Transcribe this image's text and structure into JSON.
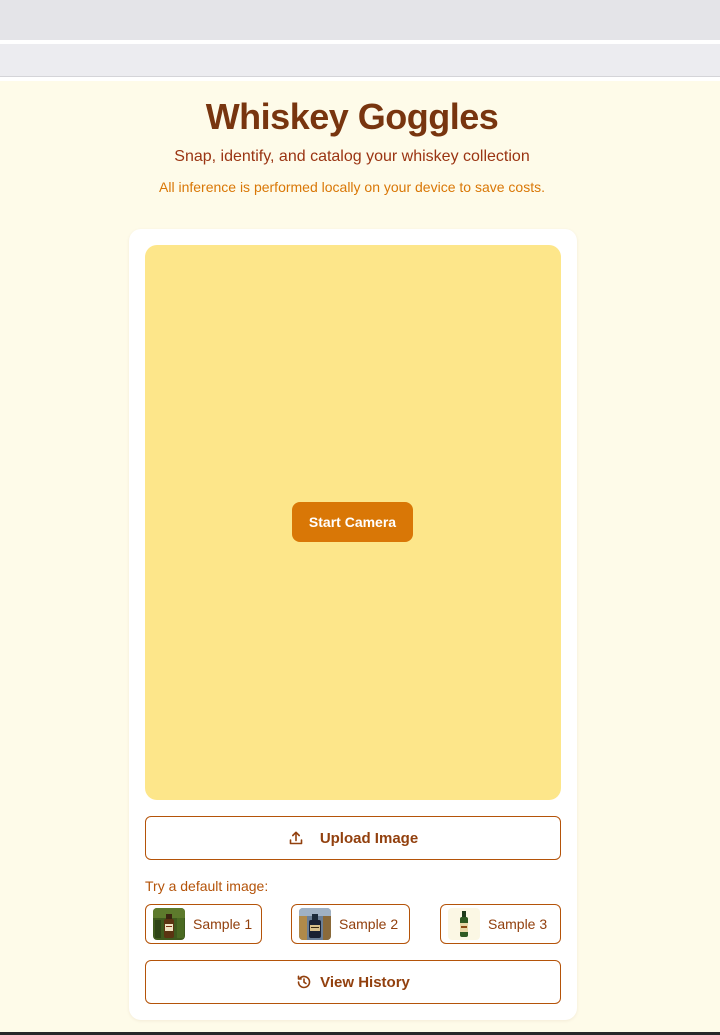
{
  "header": {
    "title": "Whiskey Goggles",
    "subtitle": "Snap, identify, and catalog your whiskey collection",
    "note": "All inference is performed locally on your device to save costs."
  },
  "camera": {
    "start_label": "Start Camera"
  },
  "upload": {
    "label": "Upload Image",
    "icon": "upload-icon"
  },
  "samples": {
    "prompt": "Try a default image:",
    "items": [
      {
        "label": "Sample 1",
        "icon": "sample-1-thumbnail"
      },
      {
        "label": "Sample 2",
        "icon": "sample-2-thumbnail"
      },
      {
        "label": "Sample 3",
        "icon": "sample-3-thumbnail"
      }
    ]
  },
  "history": {
    "label": "View History",
    "icon": "history-icon"
  },
  "colors": {
    "background": "#fefbe9",
    "title": "#78350f",
    "accent": "#d97706",
    "camera_area": "#fde68a",
    "border": "#b45309"
  }
}
